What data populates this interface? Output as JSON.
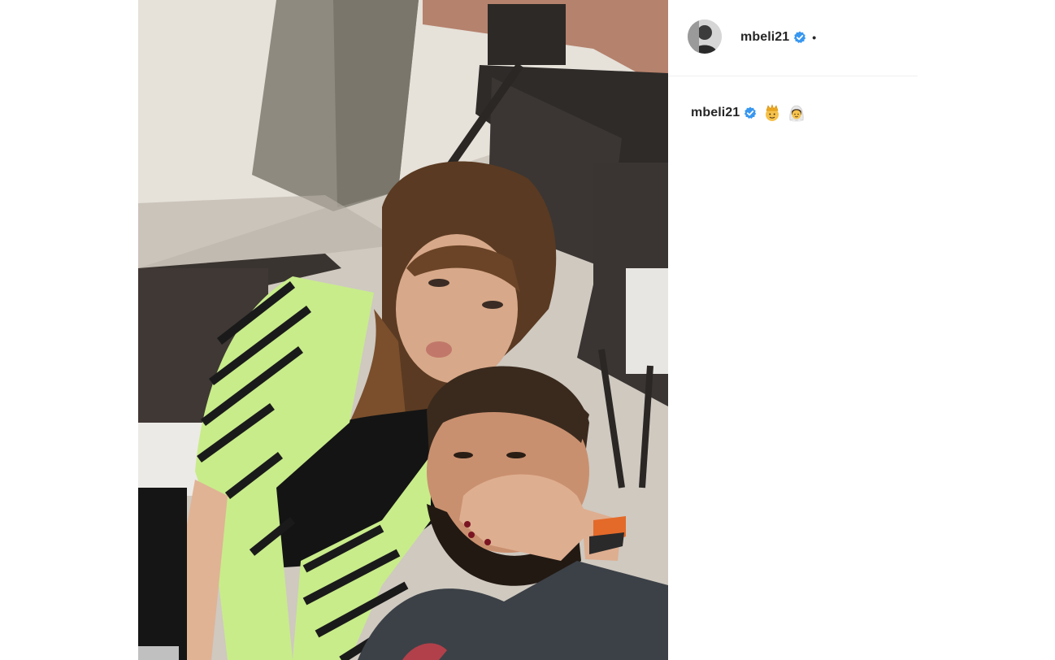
{
  "post": {
    "header": {
      "username": "mbeli21",
      "verified": true,
      "separator": "•"
    },
    "caption": {
      "username": "mbeli21",
      "verified": true,
      "emojis": [
        "man-with-crown-emoji",
        "woman-with-veil-emoji"
      ],
      "text": ""
    }
  },
  "colors": {
    "text": "#262626",
    "verified_blue": "#3897f0",
    "divider": "#efefef",
    "zebra_green": "#c8ec8a"
  }
}
